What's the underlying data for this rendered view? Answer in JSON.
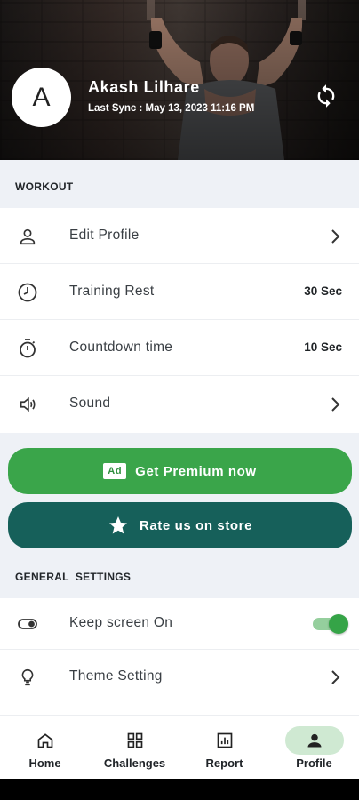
{
  "profile": {
    "avatar_letter": "A",
    "name": "Akash Lilhare",
    "last_sync": "Last Sync : May 13, 2023 11:16 PM"
  },
  "workout": {
    "section_title": "WORKOUT",
    "items": [
      {
        "label": "Edit Profile",
        "icon": "person-icon"
      },
      {
        "label": "Training Rest",
        "value": "30 Sec",
        "icon": "clock-icon"
      },
      {
        "label": "Countdown time",
        "value": "10 Sec",
        "icon": "stopwatch-icon"
      },
      {
        "label": "Sound",
        "icon": "speaker-icon"
      }
    ]
  },
  "promo": {
    "ad_badge": "Ad",
    "premium_label": "Get Premium now",
    "rate_label": "Rate us on store"
  },
  "general": {
    "section_title": "GENERAL  SETTINGS",
    "items": [
      {
        "label": "Keep screen On",
        "icon": "toggle-icon",
        "enabled": true
      },
      {
        "label": "Theme Setting",
        "icon": "lightbulb-icon"
      }
    ]
  },
  "nav": {
    "items": [
      {
        "label": "Home",
        "icon": "home-icon"
      },
      {
        "label": "Challenges",
        "icon": "grid-icon"
      },
      {
        "label": "Report",
        "icon": "chart-icon"
      },
      {
        "label": "Profile",
        "icon": "person-icon"
      }
    ],
    "active": "Profile"
  },
  "colors": {
    "primary_green": "#3aa54a",
    "dark_teal": "#16605a",
    "section_bg": "#eef1f6",
    "active_nav_bg": "#cfe9d2"
  }
}
